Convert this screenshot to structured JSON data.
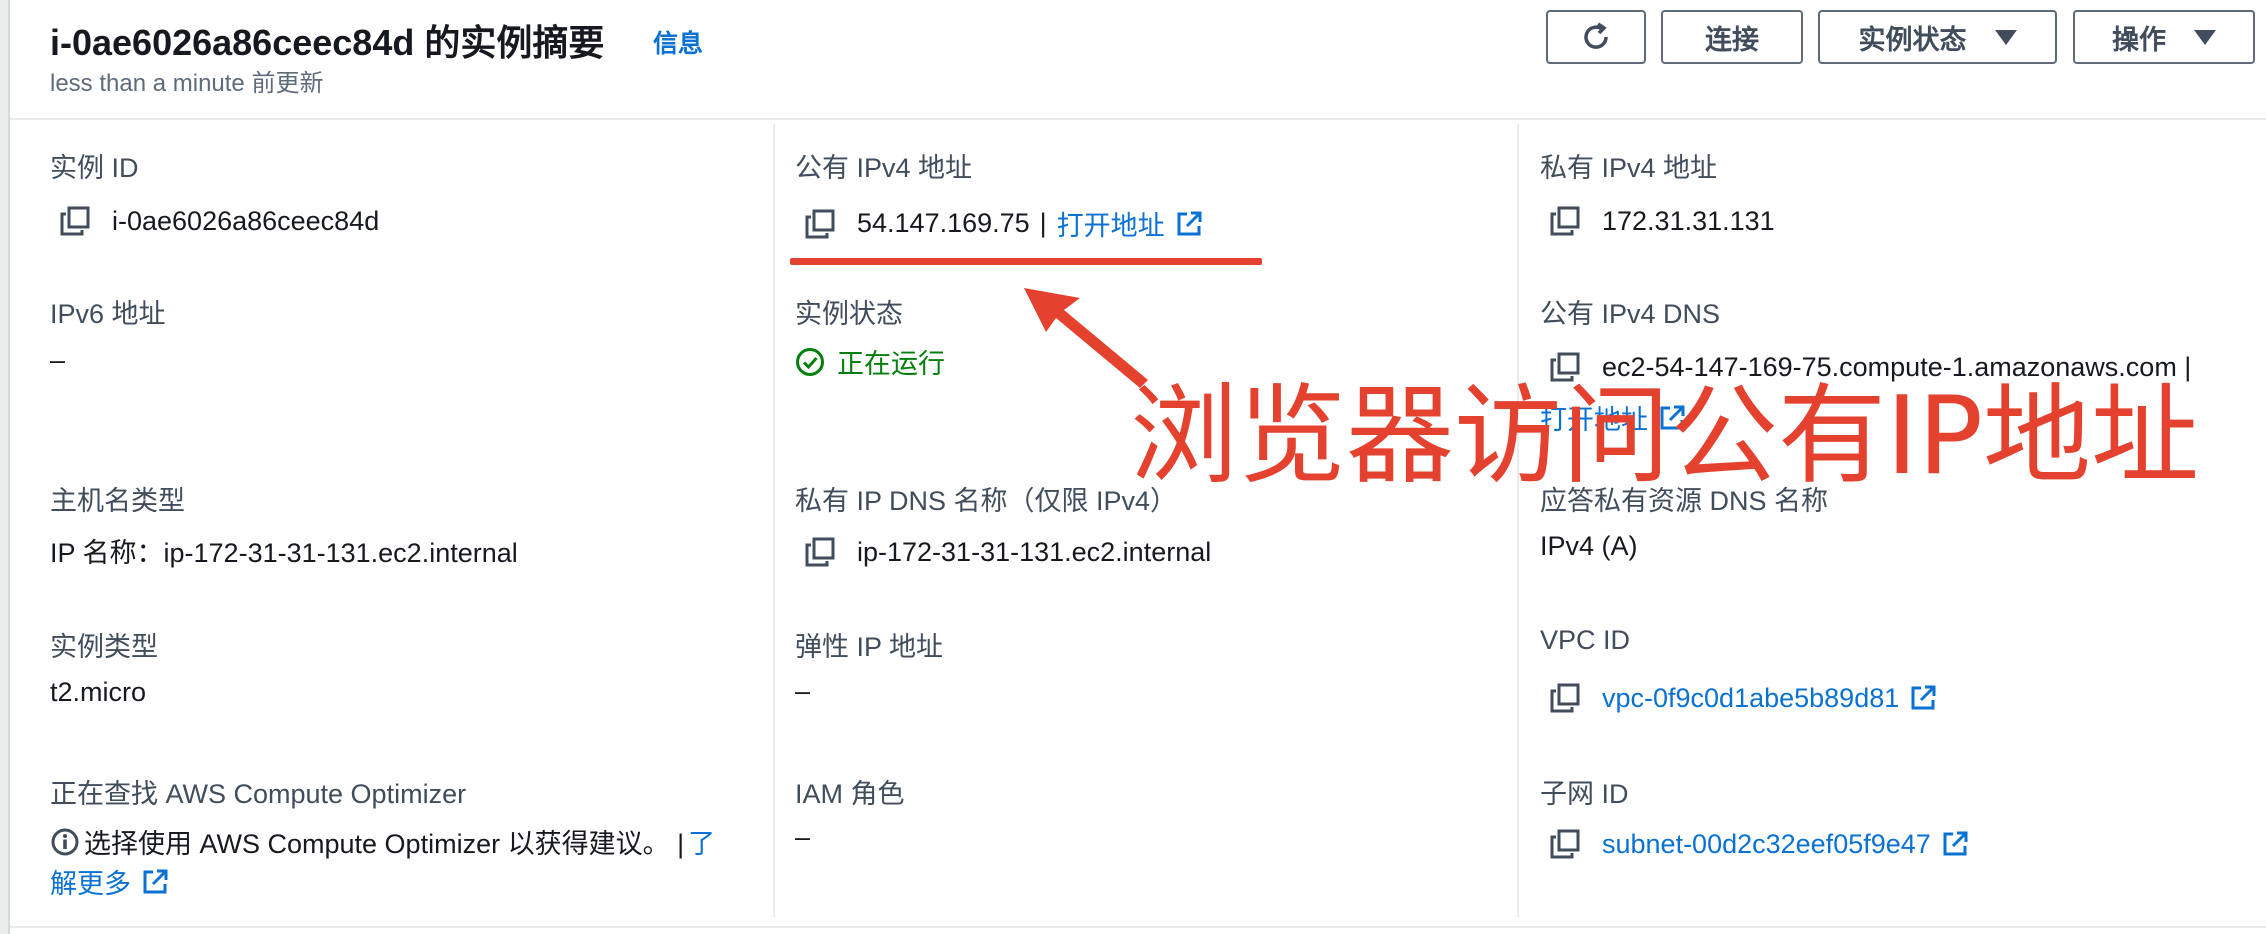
{
  "header": {
    "title": "i-0ae6026a86ceec84d 的实例摘要",
    "info": "信息",
    "subtitle": "less than a minute 前更新",
    "buttons": {
      "connect": "连接",
      "instance_state": "实例状态",
      "actions": "操作"
    }
  },
  "col1": {
    "instance_id_label": "实例 ID",
    "instance_id": "i-0ae6026a86ceec84d",
    "ipv6_label": "IPv6 地址",
    "ipv6": "–",
    "hostname_type_label": "主机名类型",
    "hostname_type": "IP 名称：ip-172-31-31-131.ec2.internal",
    "instance_type_label": "实例类型",
    "instance_type": "t2.micro",
    "optimizer_label": "正在查找 AWS Compute Optimizer",
    "optimizer_text": "选择使用 AWS Compute Optimizer 以获得建议。 |",
    "optimizer_link_1": "了",
    "optimizer_link_2": "解更多"
  },
  "col2": {
    "public_ipv4_label": "公有 IPv4 地址",
    "public_ipv4": "54.147.169.75",
    "separator": "|",
    "open_address": "打开地址",
    "state_label": "实例状态",
    "state": "正在运行",
    "private_dns_label": "私有 IP DNS 名称（仅限 IPv4）",
    "private_dns": "ip-172-31-31-131.ec2.internal",
    "elastic_ip_label": "弹性 IP 地址",
    "elastic_ip": "–",
    "iam_label": "IAM 角色",
    "iam": "–"
  },
  "col3": {
    "private_ipv4_label": "私有 IPv4 地址",
    "private_ipv4": "172.31.31.131",
    "public_dns_label": "公有 IPv4 DNS",
    "public_dns": "ec2-54-147-169-75.compute-1.amazonaws.com |",
    "open_address": "打开地址",
    "resource_dns_label": "应答私有资源 DNS 名称",
    "resource_dns": "IPv4 (A)",
    "vpc_label": "VPC ID",
    "vpc": "vpc-0f9c0d1abe5b89d81",
    "subnet_label": "子网 ID",
    "subnet": "subnet-00d2c32eef05f9e47"
  },
  "annotation": {
    "text": "浏览器访问公有IP地址",
    "color": "#e5412f"
  },
  "colors": {
    "link": "#0972d3",
    "success": "#037f0c",
    "label": "#414d5c"
  }
}
